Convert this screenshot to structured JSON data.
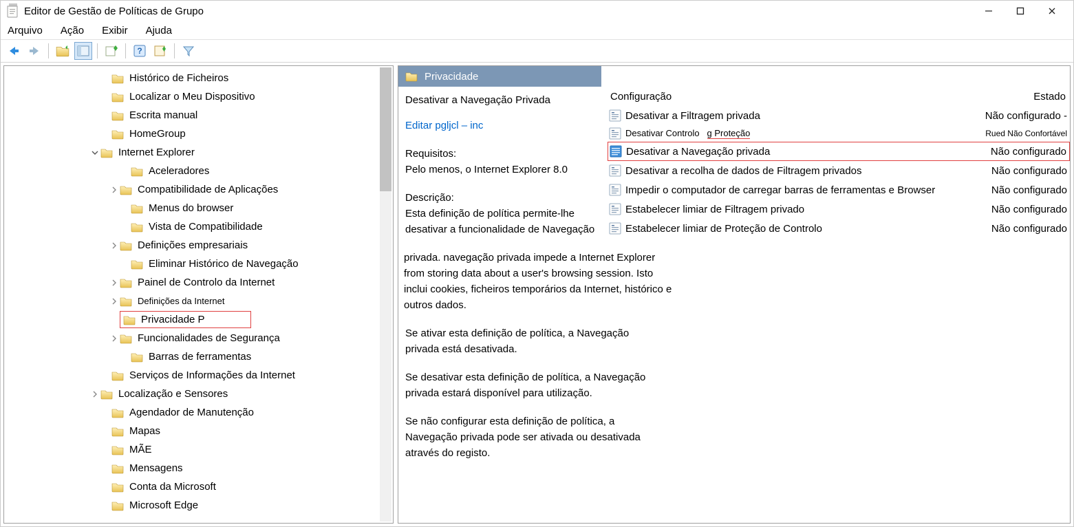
{
  "window": {
    "title": "Editor de Gestão de Políticas de Grupo"
  },
  "menu": {
    "file": "Arquivo",
    "action": "Ação",
    "view": "Exibir",
    "help": "Ajuda"
  },
  "tree": [
    {
      "indent": 140,
      "exp": "",
      "label": "Histórico de Ficheiros"
    },
    {
      "indent": 140,
      "exp": "",
      "label": "Localizar o Meu Dispositivo"
    },
    {
      "indent": 140,
      "exp": "",
      "label": "Escrita manual"
    },
    {
      "indent": 140,
      "exp": "",
      "label": "HomeGroup"
    },
    {
      "indent": 124,
      "exp": "v",
      "label": "Internet Explorer"
    },
    {
      "indent": 168,
      "exp": "",
      "label": "Aceleradores"
    },
    {
      "indent": 152,
      "exp": ">",
      "label": "Compatibilidade de Aplicações"
    },
    {
      "indent": 168,
      "exp": "",
      "label": "Menus do browser"
    },
    {
      "indent": 168,
      "exp": "",
      "label": "Vista de Compatibilidade"
    },
    {
      "indent": 152,
      "exp": ">",
      "label": "Definições empresariais"
    },
    {
      "indent": 168,
      "exp": "",
      "label": "Eliminar Histórico de Navegação"
    },
    {
      "indent": 152,
      "exp": ">",
      "label": "Painel de Controlo da Internet"
    },
    {
      "indent": 152,
      "exp": ">",
      "label": "Definições da Internet",
      "small": true
    },
    {
      "indent": 168,
      "exp": "",
      "label": "Privacidade P",
      "red": true
    },
    {
      "indent": 152,
      "exp": ">",
      "label": "Funcionalidades de Segurança"
    },
    {
      "indent": 168,
      "exp": "",
      "label": "Barras de ferramentas"
    },
    {
      "indent": 140,
      "exp": "",
      "label": "Serviços de Informações da Internet"
    },
    {
      "indent": 124,
      "exp": ">",
      "label": "Localização e Sensores"
    },
    {
      "indent": 140,
      "exp": "",
      "label": "Agendador de Manutenção"
    },
    {
      "indent": 140,
      "exp": "",
      "label": "Mapas"
    },
    {
      "indent": 140,
      "exp": "",
      "label": " MÃE"
    },
    {
      "indent": 140,
      "exp": "",
      "label": "Mensagens"
    },
    {
      "indent": 140,
      "exp": "",
      "label": "Conta da Microsoft"
    },
    {
      "indent": 140,
      "exp": "",
      "label": "Microsoft Edge"
    }
  ],
  "right": {
    "header": "Privacidade",
    "desc": {
      "title": "Desativar a Navegação Privada",
      "edit": "Editar pgljcl – inc",
      "req_label": "Requisitos:",
      "req_text": "Pelo menos, o Internet Explorer 8.0",
      "d_label": "Descrição:",
      "d1": "Esta definição de política permite-lhe desativar a funcionalidade de Navegação",
      "d2": "privada. navegação privada impede a Internet Explorer from storing data about a user's browsing session. Isto inclui cookies, ficheiros temporários da Internet, histórico e outros dados.",
      "d3": "Se ativar esta definição de política, a Navegação privada está desativada.",
      "d4": "Se desativar esta definição de política, a Navegação privada estará disponível para utilização.",
      "d5": "Se não configurar esta definição de política, a Navegação privada pode ser ativada ou desativada através do registo."
    },
    "cols": {
      "config": "Configuração",
      "state": "Estado"
    },
    "rows": [
      {
        "label": "Desativar a Filtragem privada",
        "state": "Não  configurado -",
        "small": false
      },
      {
        "label": "Desativar Controlo",
        "extra": "g Proteção",
        "state": "Rued Não Confortável",
        "small": true,
        "redunder": true
      },
      {
        "label": "Desativar a Navegação privada",
        "state": "Não configurado",
        "selected": true,
        "red": true
      },
      {
        "label": "Desativar a recolha de dados de Filtragem privados",
        "state": "Não configurado"
      },
      {
        "label": "Impedir o computador de carregar barras de ferramentas e Browser",
        "state": "Não configurado"
      },
      {
        "label": "Estabelecer limiar de Filtragem privado",
        "state": "Não configurado"
      },
      {
        "label": "Estabelecer limiar de Proteção de Controlo",
        "state": "Não configurado"
      }
    ]
  }
}
